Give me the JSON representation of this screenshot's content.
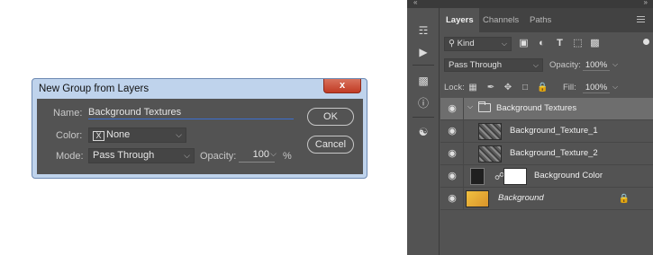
{
  "dialog": {
    "title": "New Group from Layers",
    "close_glyph": "x",
    "name_label": "Name:",
    "name_value": "Background Textures",
    "color_label": "Color:",
    "color_value": "None",
    "mode_label": "Mode:",
    "mode_value": "Pass Through",
    "opacity_label": "Opacity:",
    "opacity_value": "100",
    "opacity_unit": "%",
    "ok_label": "OK",
    "cancel_label": "Cancel",
    "x_glyph": "X"
  },
  "panel": {
    "tabs": [
      "Layers",
      "Channels",
      "Paths"
    ],
    "kind_label": "Kind",
    "blend_mode": "Pass Through",
    "opacity_label": "Opacity:",
    "opacity_value": "100%",
    "lock_label": "Lock:",
    "fill_label": "Fill:",
    "fill_value": "100%",
    "layers": [
      {
        "name": "Background Textures",
        "type": "group",
        "selected": true
      },
      {
        "name": "Background_Texture_1",
        "type": "texture"
      },
      {
        "name": "Background_Texture_2",
        "type": "texture"
      },
      {
        "name": "Background Color",
        "type": "fill"
      },
      {
        "name": "Background",
        "type": "background",
        "locked": true
      }
    ]
  },
  "icons": {
    "eye": "eye-icon",
    "chevron": "chevron-down-icon",
    "folder": "folder-icon",
    "lock": "lock-icon",
    "chain": "link-icon"
  },
  "colors": {
    "dialog_frame": "#bfd3ec",
    "dialog_body": "#535353",
    "close_button": "#c13b24",
    "input_underline": "#3b6fd1",
    "panel_bg": "#535353",
    "selected_row": "#6e6e6e"
  }
}
